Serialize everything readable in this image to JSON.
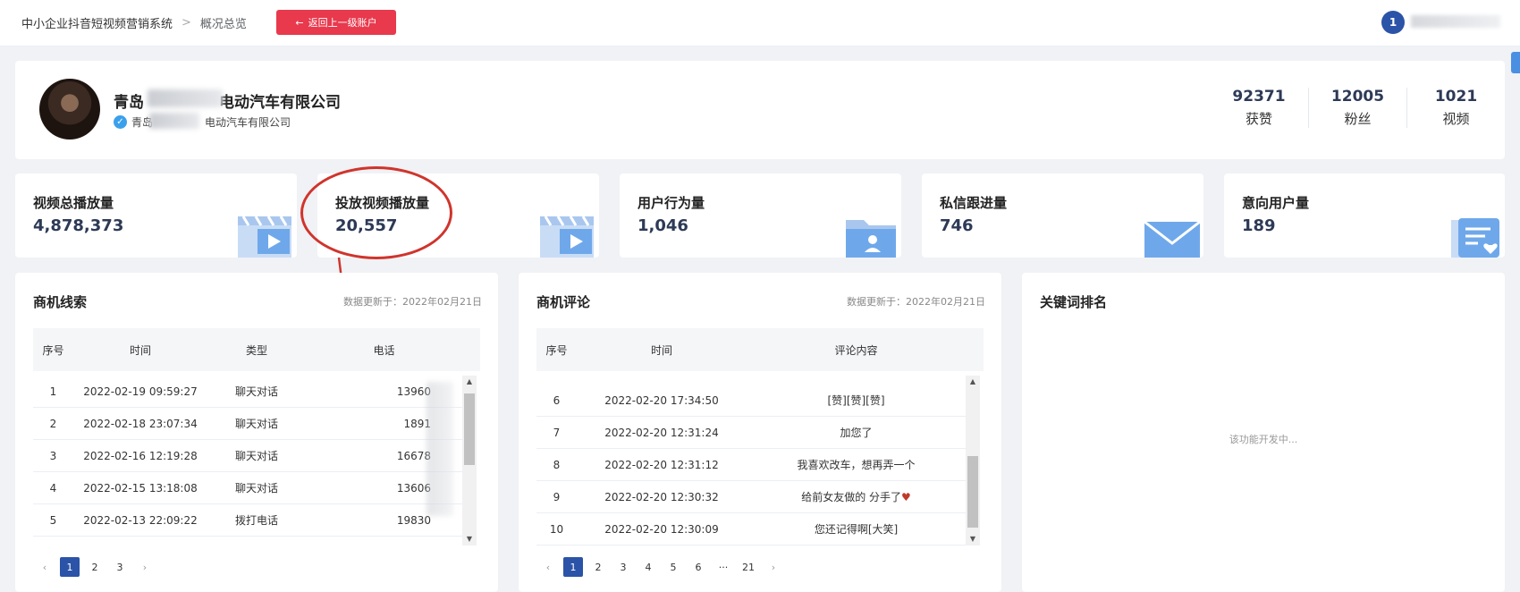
{
  "header": {
    "breadcrumb_root": "中小企业抖音短视频营销系统",
    "breadcrumb_separator": ">",
    "breadcrumb_current": "概况总览",
    "back_icon": "←",
    "back_button_label": "返回上一级账户",
    "user_badge": "1"
  },
  "profile": {
    "name_prefix": "青岛",
    "name_suffix": "电动汽车有限公司",
    "verified_icon": "✓",
    "sub_prefix": "青岛",
    "sub_suffix": "电动汽车有限公司",
    "stats": [
      {
        "value": "92371",
        "label": "获赞"
      },
      {
        "value": "12005",
        "label": "粉丝"
      },
      {
        "value": "1021",
        "label": "视频"
      }
    ]
  },
  "metrics": [
    {
      "label": "视频总播放量",
      "value": "4,878,373",
      "icon": "video-icon"
    },
    {
      "label": "投放视频播放量",
      "value": "20,557",
      "icon": "video-icon"
    },
    {
      "label": "用户行为量",
      "value": "1,046",
      "icon": "user-folder-icon"
    },
    {
      "label": "私信跟进量",
      "value": "746",
      "icon": "mail-icon"
    },
    {
      "label": "意向用户量",
      "value": "189",
      "icon": "heart-list-icon"
    }
  ],
  "leads": {
    "title": "商机线索",
    "updated": "数据更新于：2022年02月21日",
    "columns": [
      "序号",
      "时间",
      "类型",
      "电话"
    ],
    "rows": [
      {
        "no": "1",
        "time": "2022-02-19 09:59:27",
        "type": "聊天对话",
        "phone": "13960"
      },
      {
        "no": "2",
        "time": "2022-02-18 23:07:34",
        "type": "聊天对话",
        "phone": "1891"
      },
      {
        "no": "3",
        "time": "2022-02-16 12:19:28",
        "type": "聊天对话",
        "phone": "16678"
      },
      {
        "no": "4",
        "time": "2022-02-15 13:18:08",
        "type": "聊天对话",
        "phone": "13606"
      },
      {
        "no": "5",
        "time": "2022-02-13 22:09:22",
        "type": "拨打电话",
        "phone": "19830"
      }
    ],
    "pages": [
      "1",
      "2",
      "3"
    ],
    "prev": "‹",
    "next": "›"
  },
  "comments": {
    "title": "商机评论",
    "updated": "数据更新于：2022年02月21日",
    "columns": [
      "序号",
      "时间",
      "评论内容"
    ],
    "rows": [
      {
        "no": "6",
        "time": "2022-02-20 17:34:50",
        "content": "[赞][赞][赞]"
      },
      {
        "no": "7",
        "time": "2022-02-20 12:31:24",
        "content": "加您了"
      },
      {
        "no": "8",
        "time": "2022-02-20 12:31:12",
        "content": "我喜欢改车，想再弄一个"
      },
      {
        "no": "9",
        "time": "2022-02-20 12:30:32",
        "content": "给前女友做的 分手了"
      },
      {
        "no": "10",
        "time": "2022-02-20 12:30:09",
        "content": "您还记得啊[大笑]"
      }
    ],
    "pages": [
      "1",
      "2",
      "3",
      "4",
      "5",
      "6",
      "···",
      "21"
    ],
    "prev": "‹",
    "next": "›"
  },
  "keywords": {
    "title": "关键词排名",
    "placeholder": "该功能开发中..."
  }
}
